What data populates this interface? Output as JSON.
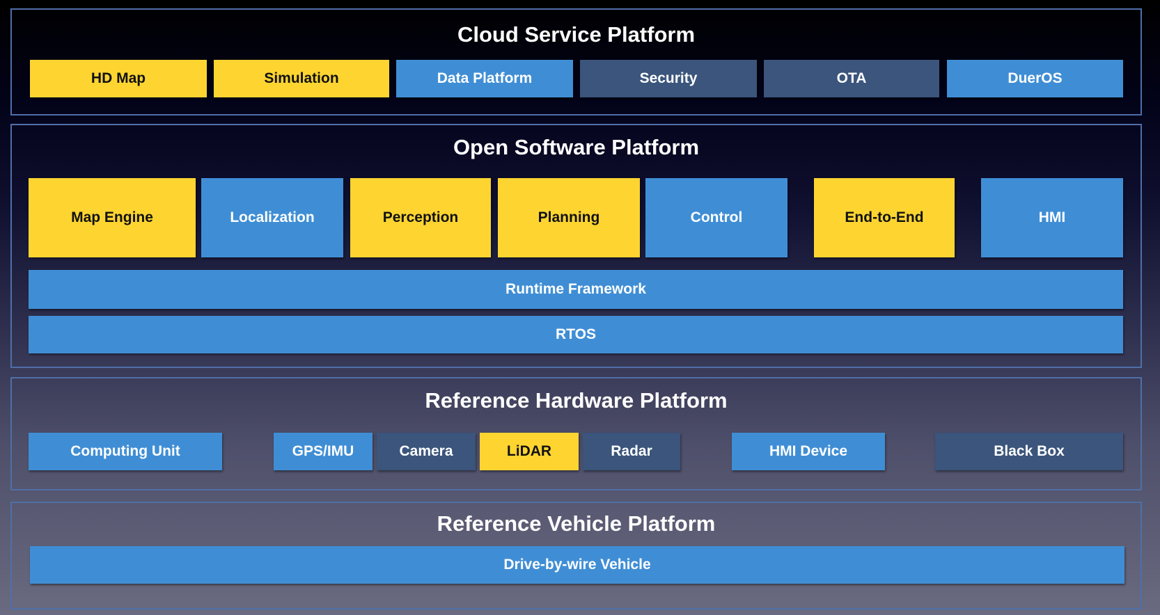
{
  "colors": {
    "yellow": "#fed530",
    "blue": "#3f8ed5",
    "navy": "#3b557c",
    "border": "#4f6fa8"
  },
  "cloud": {
    "title": "Cloud Service Platform",
    "items": [
      "HD Map",
      "Simulation",
      "Data Platform",
      "Security",
      "OTA",
      "DuerOS"
    ]
  },
  "software": {
    "title": "Open Software Platform",
    "modules": [
      "Map Engine",
      "Localization",
      "Perception",
      "Planning",
      "Control",
      "End-to-End",
      "HMI"
    ],
    "runtime": "Runtime Framework",
    "rtos": "RTOS"
  },
  "hardware": {
    "title": "Reference Hardware Platform",
    "items": [
      "Computing Unit",
      "GPS/IMU",
      "Camera",
      "LiDAR",
      "Radar",
      "HMI Device",
      "Black Box"
    ]
  },
  "vehicle": {
    "title": "Reference Vehicle Platform",
    "item": "Drive-by-wire Vehicle"
  }
}
